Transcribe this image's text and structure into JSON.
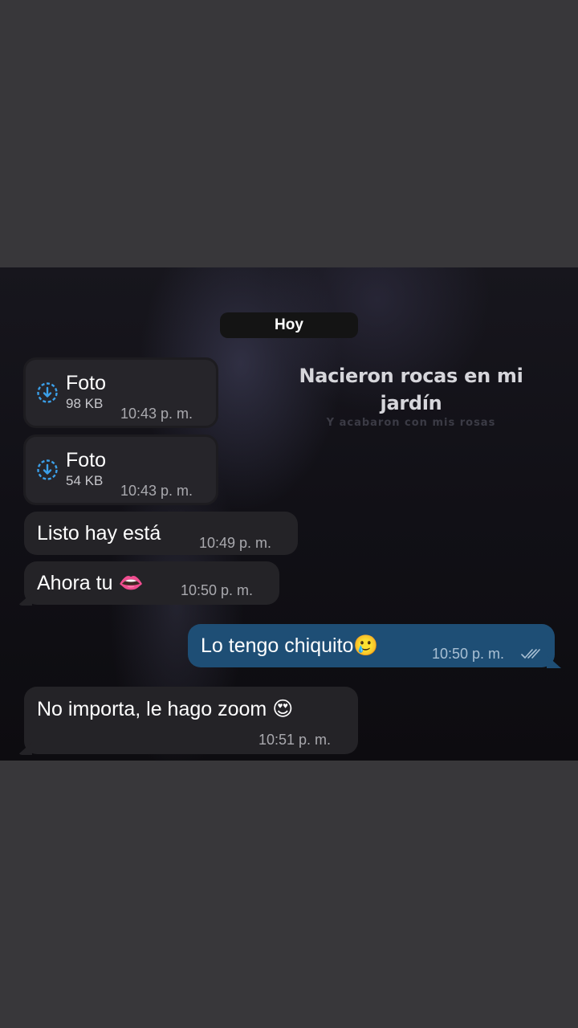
{
  "wallpaper": {
    "title": "Nacieron rocas en mi jardín",
    "subtitle": "Y acabaron con mis rosas"
  },
  "date_chip": "Hoy",
  "messages": [
    {
      "type": "file",
      "direction": "in",
      "name": "Foto",
      "size": "98 KB",
      "time": "10:43 p. m.",
      "icon": "download-icon"
    },
    {
      "type": "file",
      "direction": "in",
      "name": "Foto",
      "size": "54 KB",
      "time": "10:43 p. m.",
      "icon": "download-icon"
    },
    {
      "type": "text",
      "direction": "in",
      "text": "Listo hay está",
      "time": "10:49 p. m."
    },
    {
      "type": "text",
      "direction": "in",
      "text": "Ahora tu 👄",
      "time": "10:50 p. m."
    },
    {
      "type": "text",
      "direction": "out",
      "text": "Lo tengo chiquito🥲",
      "time": "10:50 p. m.",
      "status": "read-checks-icon"
    },
    {
      "type": "text",
      "direction": "in",
      "text": "No importa, le hago zoom 😍",
      "time": "10:51 p. m."
    }
  ],
  "colors": {
    "outer_background": "#38373a",
    "incoming_bubble": "#242327",
    "outgoing_bubble": "#1e4e75",
    "download_icon": "#3b9fe8"
  }
}
